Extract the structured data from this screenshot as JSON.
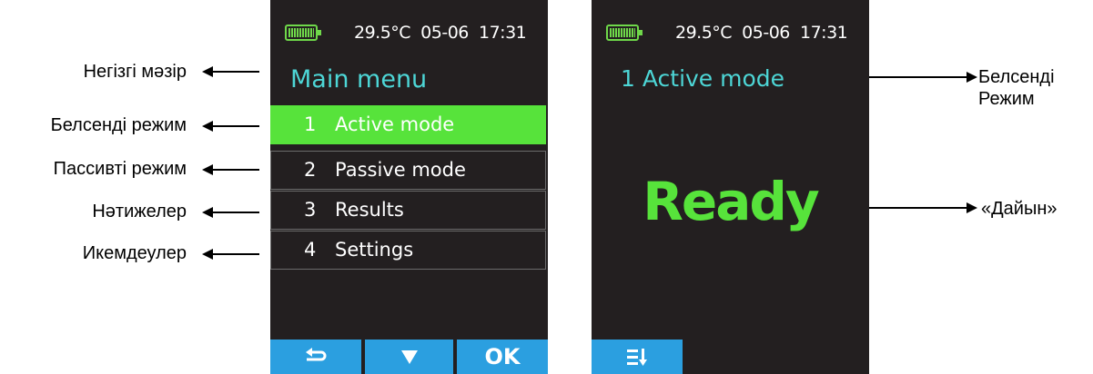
{
  "device_left": {
    "status": {
      "temperature": "29.5°C",
      "date": "05-06",
      "time": "17:31"
    },
    "title": "Main menu",
    "menu_items": [
      {
        "number": "1",
        "label": "Active mode",
        "selected": true
      },
      {
        "number": "2",
        "label": "Passive mode",
        "selected": false
      },
      {
        "number": "3",
        "label": "Results",
        "selected": false
      },
      {
        "number": "4",
        "label": "Settings",
        "selected": false
      }
    ],
    "softkeys": [
      {
        "icon": "back-arrow-icon",
        "label": ""
      },
      {
        "icon": "down-triangle-icon",
        "label": ""
      },
      {
        "icon": "",
        "label": "OK"
      }
    ]
  },
  "device_right": {
    "status": {
      "temperature": "29.5°C",
      "date": "05-06",
      "time": "17:31"
    },
    "title": "1 Active mode",
    "ready_text": "Ready",
    "softkeys": [
      {
        "icon": "menu-sort-icon",
        "label": ""
      }
    ]
  },
  "annotations_left": [
    "Негізгі мәзір",
    "Белсенді режим",
    "Пассивті режим",
    "Нәтижелер",
    "Икемдеулер"
  ],
  "annotations_right": [
    {
      "line1": "Белсенді",
      "line2": "Режим"
    },
    {
      "line1": "«Дайын»",
      "line2": ""
    }
  ],
  "colors": {
    "screen_bg": "#231f20",
    "title_cyan": "#4dd6d6",
    "highlight_green": "#57e33b",
    "softkey_blue": "#2b9fe0",
    "battery_green": "#6fd84a"
  }
}
